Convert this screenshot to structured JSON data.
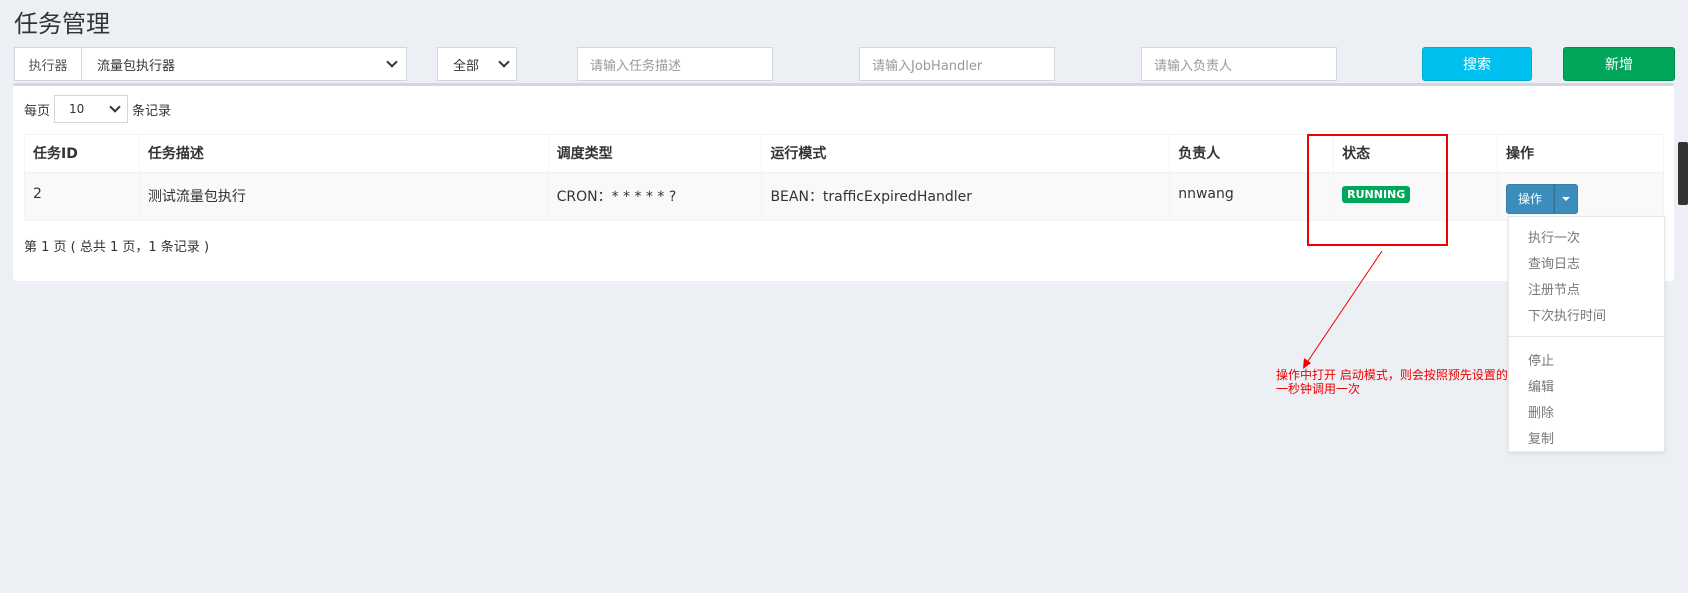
{
  "page": {
    "title": "任务管理"
  },
  "filters": {
    "executor_label": "执行器",
    "executor_value": "流量包执行器",
    "status_value": "全部",
    "desc_placeholder": "请输入任务描述",
    "handler_placeholder": "请输入JobHandler",
    "author_placeholder": "请输入负责人",
    "search_label": "搜索",
    "add_label": "新增"
  },
  "pagination": {
    "per_page_prefix": "每页",
    "per_page_value": "10",
    "per_page_suffix": "条记录",
    "info": "第 1 页 ( 总共 1 页，1 条记录 )"
  },
  "table": {
    "headers": [
      "任务ID",
      "任务描述",
      "调度类型",
      "运行模式",
      "负责人",
      "状态",
      "操作"
    ],
    "rows": [
      {
        "id": "2",
        "desc": "测试流量包执行",
        "schedule": "CRON：* * * * * ?",
        "mode": "BEAN：trafficExpiredHandler",
        "author": "nnwang",
        "status": "RUNNING",
        "op_label": "操作"
      }
    ]
  },
  "dropdown": {
    "items_top": [
      "执行一次",
      "查询日志",
      "注册节点",
      "下次执行时间"
    ],
    "items_bottom": [
      "停止",
      "编辑",
      "删除",
      "复制"
    ]
  },
  "annotation": {
    "line1": "操作中打开 启动模式，则会按照预先设置的，",
    "line2": "一秒钟调用一次"
  },
  "colors": {
    "search": "#00c0ef",
    "add": "#00a65a",
    "running": "#00a65a",
    "op": "#3c8dbc",
    "annotation": "#ee0000"
  }
}
